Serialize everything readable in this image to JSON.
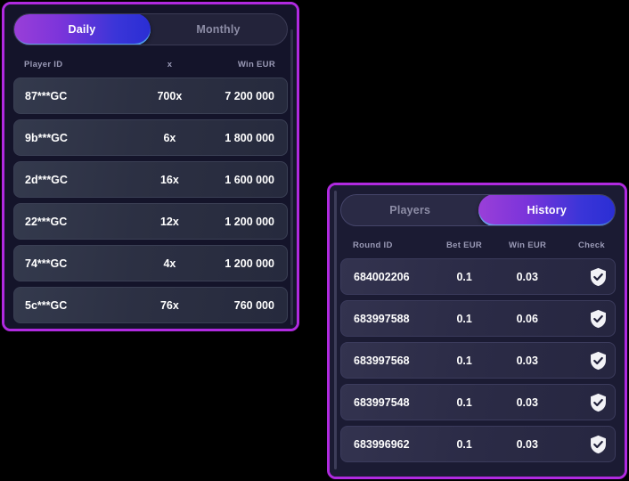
{
  "theme": {
    "page_background": "#000000",
    "panel_border": "#b02ae0",
    "accent_gradient_start": "#9a3fd8",
    "accent_gradient_end": "#2a2ed4",
    "active_tab_underline": "#5abeeb",
    "row_text": "#ffffff",
    "header_text": "#9a9ab6"
  },
  "leaderboard": {
    "tabs": [
      {
        "label": "Daily",
        "active": true
      },
      {
        "label": "Monthly",
        "active": false
      }
    ],
    "columns": [
      "Player ID",
      "x",
      "Win  EUR"
    ],
    "rows": [
      {
        "player_id": "87***GC",
        "multiplier": "700x",
        "win": "7 200 000"
      },
      {
        "player_id": "9b***GC",
        "multiplier": "6x",
        "win": "1 800 000"
      },
      {
        "player_id": "2d***GC",
        "multiplier": "16x",
        "win": "1 600 000"
      },
      {
        "player_id": "22***GC",
        "multiplier": "12x",
        "win": "1 200 000"
      },
      {
        "player_id": "74***GC",
        "multiplier": "4x",
        "win": "1 200 000"
      },
      {
        "player_id": "5c***GC",
        "multiplier": "76x",
        "win": "760 000"
      }
    ]
  },
  "history": {
    "tabs": [
      {
        "label": "Players",
        "active": false
      },
      {
        "label": "History",
        "active": true
      }
    ],
    "columns": [
      "Round ID",
      "Bet  EUR",
      "Win  EUR",
      "Check"
    ],
    "check_icon": "shield-check-icon",
    "rows": [
      {
        "round_id": "684002206",
        "bet": "0.1",
        "win": "0.03"
      },
      {
        "round_id": "683997588",
        "bet": "0.1",
        "win": "0.06"
      },
      {
        "round_id": "683997568",
        "bet": "0.1",
        "win": "0.03"
      },
      {
        "round_id": "683997548",
        "bet": "0.1",
        "win": "0.03"
      },
      {
        "round_id": "683996962",
        "bet": "0.1",
        "win": "0.03"
      }
    ]
  }
}
